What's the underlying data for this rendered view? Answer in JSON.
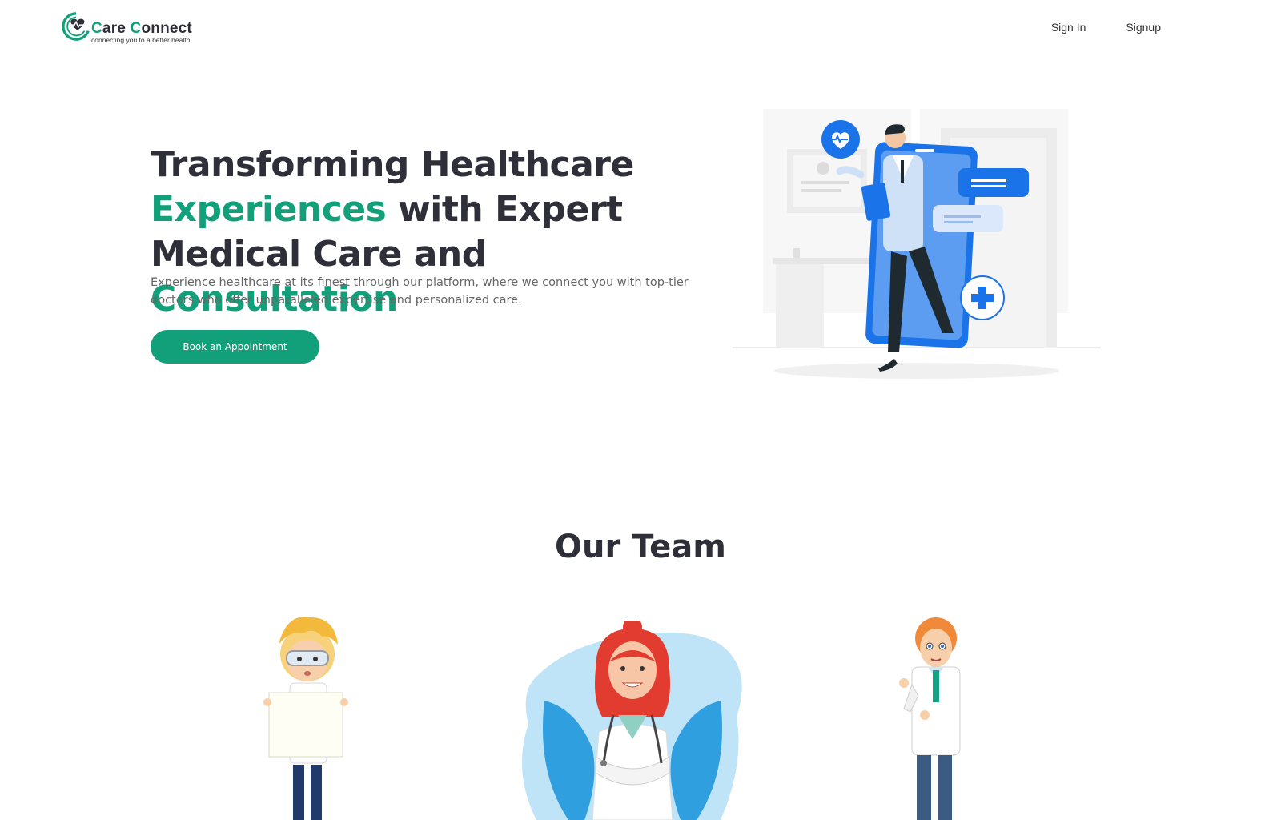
{
  "header": {
    "brand_part1": "C",
    "brand_part2": "are ",
    "brand_part3": "C",
    "brand_part4": "onnect",
    "tagline": "connecting you to a better health",
    "nav": {
      "sign_in": "Sign In",
      "signup": "Signup"
    }
  },
  "hero": {
    "title_line1": "Transforming Healthcare",
    "title_line2_green": "Experiences",
    "title_line2_rest": " with Expert",
    "title_line3_dark": "Medical Care and ",
    "title_line3_green": "Consultation",
    "subtitle": "Experience healthcare at its finest through our platform, where we connect you with top-tier doctors who offer unparalleled expertise and personalized care.",
    "cta_label": "Book an Appointment"
  },
  "team": {
    "title": "Our Team"
  },
  "colors": {
    "brand_green": "#12a07b",
    "text_dark": "#2f2f3a",
    "accent_blue": "#1a73e8"
  }
}
